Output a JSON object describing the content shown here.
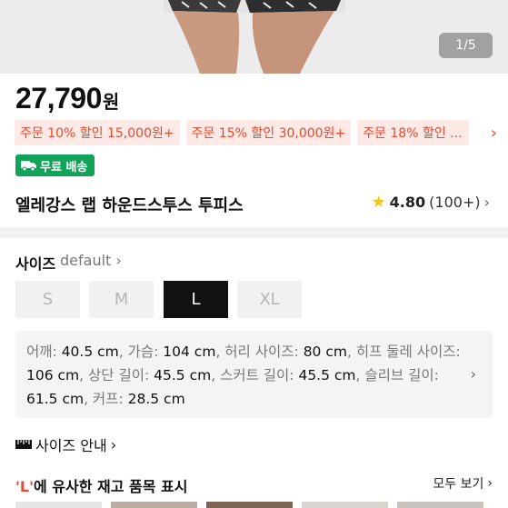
{
  "gallery": {
    "counter": "1/5"
  },
  "product": {
    "price": "27,790",
    "currency": "원",
    "title": "엘레강스 랩 하운드스투스 투피스",
    "rating": "4.80",
    "review_count": "(100+)"
  },
  "coupons": [
    "주문 10% 할인 15,000원+",
    "주문 15% 할인 30,000원+",
    "주문 18% 할인 ..."
  ],
  "shipping": {
    "label": "무료 배송"
  },
  "size": {
    "label": "사이즈",
    "selected_hint": "default",
    "options": [
      {
        "label": "S",
        "state": "disabled"
      },
      {
        "label": "M",
        "state": "disabled"
      },
      {
        "label": "L",
        "state": "selected"
      },
      {
        "label": "XL",
        "state": "disabled"
      }
    ]
  },
  "measurements": [
    {
      "name": "어깨:",
      "value": "40.5 cm"
    },
    {
      "name": "가슴:",
      "value": "104 cm"
    },
    {
      "name": "허리 사이즈:",
      "value": "80 cm"
    },
    {
      "name": "히프 둘레 사이즈:",
      "value": "106 cm"
    },
    {
      "name": "상단 길이:",
      "value": "45.5 cm"
    },
    {
      "name": "스커트 길이:",
      "value": "45.5 cm"
    },
    {
      "name": "슬리브 길이:",
      "value": "61.5 cm"
    },
    {
      "name": "커프:",
      "value": "28.5 cm"
    }
  ],
  "size_guide": {
    "label": "사이즈 안내"
  },
  "similar": {
    "title_quote": "'L'",
    "title_rest": "에 유사한 재고 품목 표시",
    "view_all": "모두 보기"
  },
  "colors": {
    "accent": "#e8482c",
    "coupon_bg": "#fde9e5",
    "free_ship": "#12a35a",
    "star": "#f5c518"
  }
}
